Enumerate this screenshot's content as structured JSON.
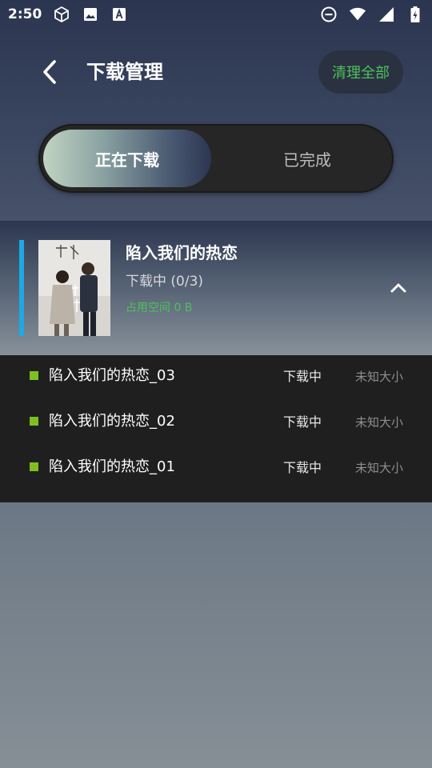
{
  "status_bar": {
    "time": "2:50",
    "left_icons": [
      "cube-icon",
      "image-icon",
      "font-icon"
    ],
    "right_icons": [
      "do-not-disturb-icon",
      "wifi-icon",
      "signal-icon",
      "battery-icon"
    ]
  },
  "header": {
    "back_icon": "chevron-left-icon",
    "title": "下载管理",
    "clear_all_label": "清理全部"
  },
  "tabs": [
    {
      "label": "正在下载",
      "active": true
    },
    {
      "label": "已完成",
      "active": false
    }
  ],
  "download_group": {
    "title": "陷入我们的热恋",
    "status": "下载中 (0/3)",
    "space": "占用空间 0 B",
    "expanded": true
  },
  "episodes": [
    {
      "name": "陷入我们的热恋_03",
      "status": "下载中",
      "size": "未知大小"
    },
    {
      "name": "陷入我们的热恋_02",
      "status": "下载中",
      "size": "未知大小"
    },
    {
      "name": "陷入我们的热恋_01",
      "status": "下载中",
      "size": "未知大小"
    }
  ],
  "colors": {
    "accent_green": "#4cc259",
    "accent_blue_bar": "#1ea8e4",
    "episode_dot": "#7fbf1f"
  }
}
